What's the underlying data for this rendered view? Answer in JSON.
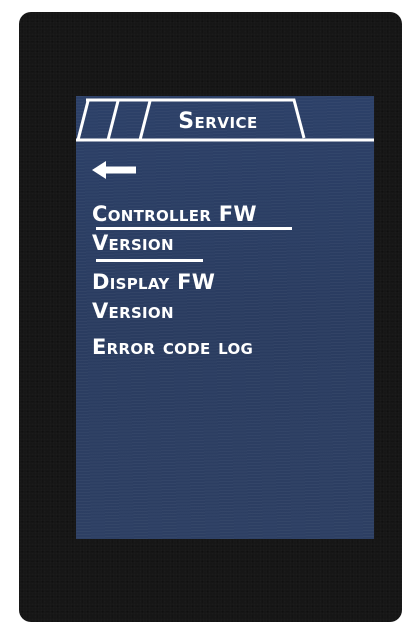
{
  "header": {
    "title": "Service"
  },
  "navigation": {
    "back_icon": "left-arrow-icon"
  },
  "menu": {
    "items": [
      {
        "lines": [
          "Controller FW",
          "Version"
        ],
        "selected": true
      },
      {
        "lines": [
          "Display FW",
          "Version"
        ],
        "selected": false
      },
      {
        "lines": [
          "Error code log"
        ],
        "selected": false
      }
    ]
  },
  "colors": {
    "screen_background": "#2b3d63",
    "device_bezel": "#161616",
    "text": "#ffffff"
  }
}
